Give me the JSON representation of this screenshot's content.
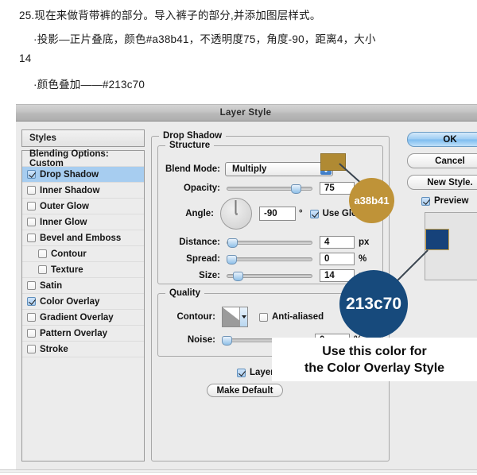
{
  "tutorial": {
    "line1": "25.现在来做背带裤的部分。导入裤子的部分,并添加图层样式。",
    "line2": "·投影—正片叠底，颜色#a38b41，不透明度75，角度-90，距离4，大小",
    "line2b": "14",
    "line3": "·颜色叠加——#213c70"
  },
  "dialog": {
    "title": "Layer Style",
    "styles_header": "Styles",
    "styles_items": [
      {
        "label": "Blending Options: Custom",
        "checkbox": false,
        "checked": false,
        "selected": false,
        "indent": false
      },
      {
        "label": "Drop Shadow",
        "checkbox": true,
        "checked": true,
        "selected": true,
        "indent": false
      },
      {
        "label": "Inner Shadow",
        "checkbox": true,
        "checked": false,
        "selected": false,
        "indent": false
      },
      {
        "label": "Outer Glow",
        "checkbox": true,
        "checked": false,
        "selected": false,
        "indent": false
      },
      {
        "label": "Inner Glow",
        "checkbox": true,
        "checked": false,
        "selected": false,
        "indent": false
      },
      {
        "label": "Bevel and Emboss",
        "checkbox": true,
        "checked": false,
        "selected": false,
        "indent": false
      },
      {
        "label": "Contour",
        "checkbox": true,
        "checked": false,
        "selected": false,
        "indent": true
      },
      {
        "label": "Texture",
        "checkbox": true,
        "checked": false,
        "selected": false,
        "indent": true
      },
      {
        "label": "Satin",
        "checkbox": true,
        "checked": false,
        "selected": false,
        "indent": false
      },
      {
        "label": "Color Overlay",
        "checkbox": true,
        "checked": true,
        "selected": false,
        "indent": false
      },
      {
        "label": "Gradient Overlay",
        "checkbox": true,
        "checked": false,
        "selected": false,
        "indent": false
      },
      {
        "label": "Pattern Overlay",
        "checkbox": true,
        "checked": false,
        "selected": false,
        "indent": false
      },
      {
        "label": "Stroke",
        "checkbox": true,
        "checked": false,
        "selected": false,
        "indent": false
      }
    ],
    "drop_shadow": {
      "group_title": "Drop Shadow",
      "structure_title": "Structure",
      "blend_mode_label": "Blend Mode:",
      "blend_mode_value": "Multiply",
      "shadow_color": "#b08a33",
      "opacity_label": "Opacity:",
      "opacity_value": "75",
      "opacity_unit": "%",
      "angle_label": "Angle:",
      "angle_value": "-90",
      "angle_unit": "°",
      "use_global_light_label": "Use Global L",
      "use_global_light_checked": true,
      "distance_label": "Distance:",
      "distance_value": "4",
      "distance_unit": "px",
      "spread_label": "Spread:",
      "spread_value": "0",
      "spread_unit": "%",
      "size_label": "Size:",
      "size_value": "14",
      "size_unit": "px"
    },
    "quality": {
      "group_title": "Quality",
      "contour_label": "Contour:",
      "anti_aliased_label": "Anti-aliased",
      "anti_aliased_checked": false,
      "noise_label": "Noise:",
      "noise_value": "0",
      "noise_unit": "%"
    },
    "layer_knockout_label": "Layer Kno",
    "layer_knockout_checked": true,
    "make_default_label": "Make Default",
    "buttons": {
      "ok": "OK",
      "cancel": "Cancel",
      "new_style": "New Style.",
      "preview_label": "Preview",
      "preview_checked": true
    }
  },
  "annotations": {
    "gold_circle": "a38b41",
    "blue_circle": "213c70",
    "gold_color": "#bf9338",
    "blue_color": "#174a7c",
    "callout_line1": "Use this color for",
    "callout_line2": "the Color Overlay Style",
    "overlay_swatch_color": "#16427a"
  }
}
